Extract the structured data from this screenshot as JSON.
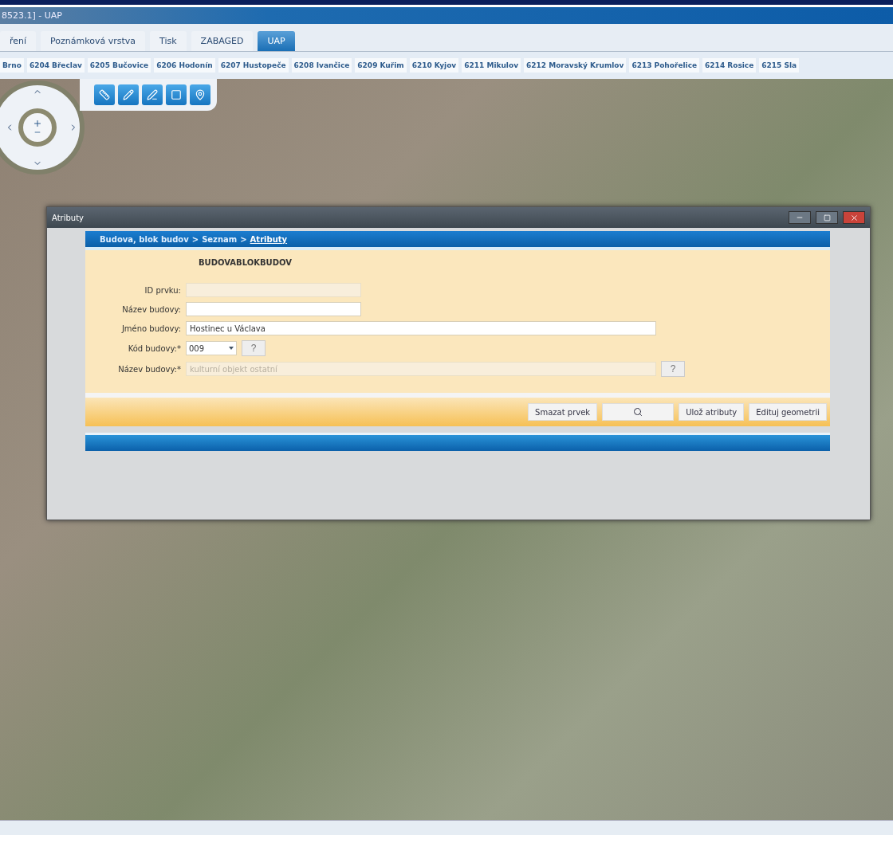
{
  "window": {
    "title": "8523.1] - UAP"
  },
  "tabs": [
    {
      "label": "ření",
      "selected": false
    },
    {
      "label": "Poznámková vrstva",
      "selected": false
    },
    {
      "label": "Tisk",
      "selected": false
    },
    {
      "label": "ZABAGED",
      "selected": false
    },
    {
      "label": "UAP",
      "selected": true
    }
  ],
  "districts": [
    "Brno",
    "6204 Břeclav",
    "6205 Bučovice",
    "6206 Hodonín",
    "6207 Hustopeče",
    "6208 Ivančice",
    "6209 Kuřim",
    "6210 Kyjov",
    "6211 Mikulov",
    "6212 Moravský Krumlov",
    "6213 Pohořelice",
    "6214 Rosice",
    "6215 Sla"
  ],
  "dialog": {
    "title": "Atributy",
    "breadcrumb": [
      {
        "label": "Budova, blok budov",
        "link": false
      },
      {
        "label": "Seznam",
        "link": false
      },
      {
        "label": "Atributy",
        "link": true
      }
    ],
    "separator": ">",
    "heading": "BUDOVABLOKBUDOV",
    "fields": [
      {
        "kind": "text",
        "label": "ID prvku:",
        "disabled": true,
        "wide": false
      },
      {
        "kind": "text",
        "label": "Název budovy:",
        "disabled": false,
        "wide": false
      },
      {
        "kind": "text",
        "label": "Jméno budovy:",
        "value": "Hostinec u Václava",
        "disabled": false,
        "wide": true
      },
      {
        "kind": "select",
        "label": "Kód budovy:*",
        "value": "009",
        "help": "?"
      },
      {
        "kind": "text",
        "label": "Název budovy:*",
        "value": "kulturní objekt ostatní",
        "disabled": true,
        "wide": true,
        "help": "?"
      }
    ],
    "buttons": [
      {
        "kind": "text",
        "label": "Smazat prvek"
      },
      {
        "kind": "search"
      },
      {
        "kind": "text",
        "label": "Ulož atributy"
      },
      {
        "kind": "text",
        "label": "Edituj geometrii"
      }
    ]
  }
}
